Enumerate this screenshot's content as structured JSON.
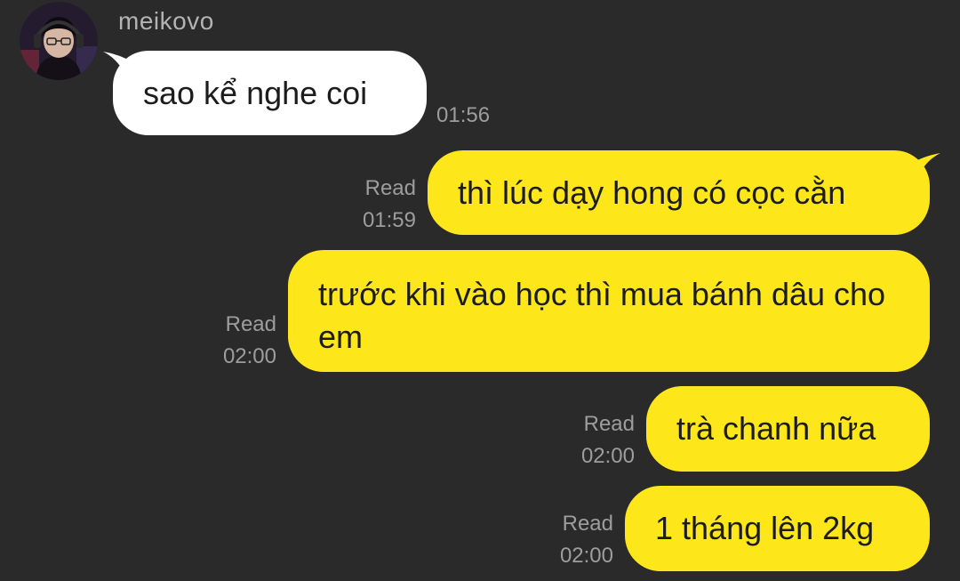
{
  "conversation": {
    "contact": {
      "name": "meikovo",
      "avatar_icon": "user-avatar"
    },
    "messages": [
      {
        "direction": "incoming",
        "text": "sao kể nghe coi",
        "time": "01:56"
      },
      {
        "direction": "outgoing",
        "text": "thì lúc dạy hong có cọc cằn",
        "status": "Read",
        "time": "01:59"
      },
      {
        "direction": "outgoing",
        "text": "trước khi vào học thì mua bánh dâu cho em",
        "status": "Read",
        "time": "02:00"
      },
      {
        "direction": "outgoing",
        "text": "trà chanh nữa",
        "status": "Read",
        "time": "02:00"
      },
      {
        "direction": "outgoing",
        "text": "1 tháng lên 2kg",
        "status": "Read",
        "time": "02:00"
      }
    ]
  },
  "colors": {
    "background": "#2a2a2b",
    "incoming_bubble": "#ffffff",
    "outgoing_bubble": "#fde71b",
    "meta_text": "#9d9d9d"
  }
}
